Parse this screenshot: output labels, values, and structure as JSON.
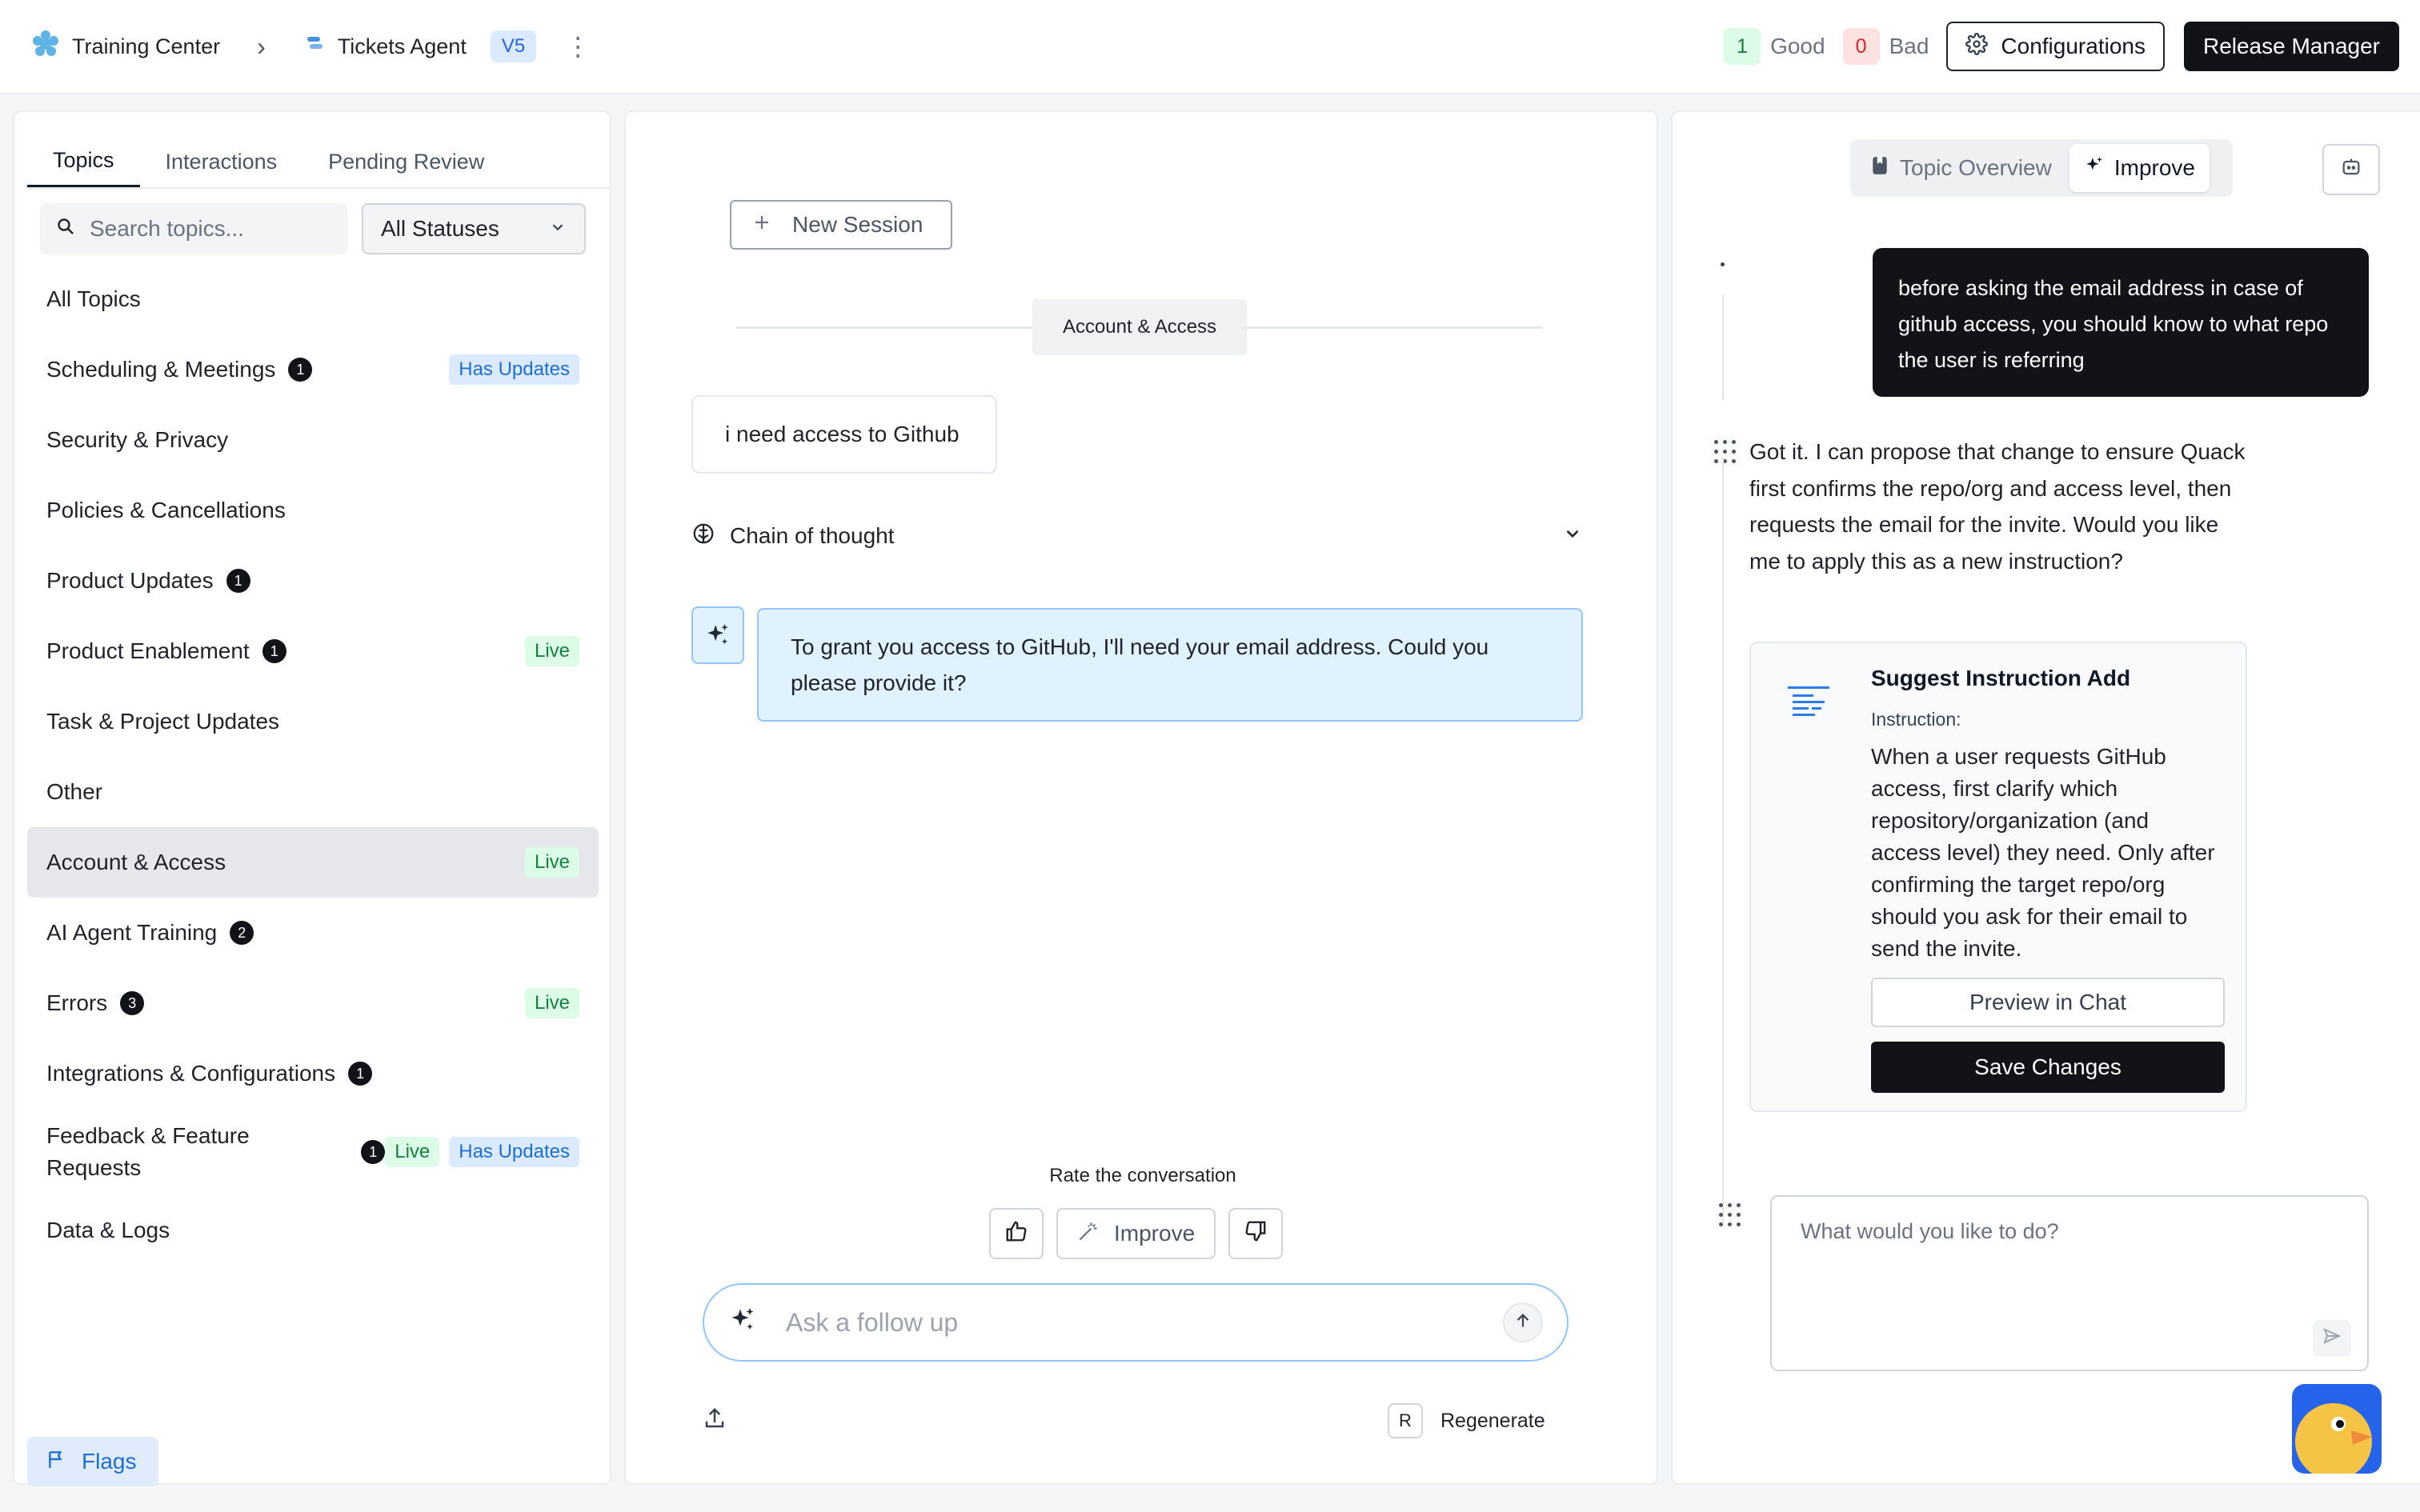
{
  "header": {
    "breadcrumb_root": "Training Center",
    "breadcrumb_agent": "Tickets Agent",
    "version": "V5",
    "good_count": "1",
    "good_label": "Good",
    "bad_count": "0",
    "bad_label": "Bad",
    "configurations_label": "Configurations",
    "release_manager_label": "Release Manager"
  },
  "left": {
    "tabs": [
      "Topics",
      "Interactions",
      "Pending Review"
    ],
    "active_tab": "Topics",
    "search_placeholder": "Search topics...",
    "status_filter": "All Statuses",
    "topics": [
      {
        "name": "All Topics",
        "count": null,
        "live": false,
        "updates": false,
        "selected": false
      },
      {
        "name": "Scheduling & Meetings",
        "count": "1",
        "live": false,
        "updates": true,
        "selected": false
      },
      {
        "name": "Security & Privacy",
        "count": null,
        "live": false,
        "updates": false,
        "selected": false
      },
      {
        "name": "Policies & Cancellations",
        "count": null,
        "live": false,
        "updates": false,
        "selected": false
      },
      {
        "name": "Product Updates",
        "count": "1",
        "live": false,
        "updates": false,
        "selected": false
      },
      {
        "name": "Product Enablement",
        "count": "1",
        "live": true,
        "updates": false,
        "selected": false
      },
      {
        "name": "Task & Project Updates",
        "count": null,
        "live": false,
        "updates": false,
        "selected": false
      },
      {
        "name": "Other",
        "count": null,
        "live": false,
        "updates": false,
        "selected": false
      },
      {
        "name": "Account & Access",
        "count": null,
        "live": true,
        "updates": false,
        "selected": true
      },
      {
        "name": "AI Agent Training",
        "count": "2",
        "live": false,
        "updates": false,
        "selected": false
      },
      {
        "name": "Errors",
        "count": "3",
        "live": true,
        "updates": false,
        "selected": false
      },
      {
        "name": "Integrations & Configurations",
        "count": "1",
        "live": false,
        "updates": false,
        "selected": false
      },
      {
        "name": "Feedback & Feature Requests",
        "count": "1",
        "live": true,
        "updates": true,
        "selected": false,
        "two_line": true
      },
      {
        "name": "Data & Logs",
        "count": null,
        "live": false,
        "updates": false,
        "selected": false
      }
    ],
    "live_label": "Live",
    "updates_label": "Has Updates",
    "flags_label": "Flags"
  },
  "middle": {
    "new_session_label": "New Session",
    "topic_divider": "Account & Access",
    "user_message": "i need access to Github",
    "chain_of_thought_label": "Chain of thought",
    "agent_message": "To grant you access to GitHub, I'll need your email address. Could you please provide it?",
    "rate_label": "Rate the conversation",
    "improve_label": "Improve",
    "ask_placeholder": "Ask a follow up",
    "regenerate_key": "R",
    "regenerate_label": "Regenerate"
  },
  "right": {
    "tab_overview": "Topic Overview",
    "tab_improve": "Improve",
    "user_bubble": "before asking the email address in case of github access, you should know to what repo the user is referring",
    "bot_reply": "Got it. I can propose that change to ensure Quack first confirms the repo/org and access level, then requests the email for the invite. Would you like me to apply this as a new instruction?",
    "suggestion": {
      "title": "Suggest Instruction Add",
      "label": "Instruction:",
      "text": "When a user requests GitHub access, first clarify which repository/organization (and access level) they need. Only after confirming the target repo/org should you ask for their email to send the invite.",
      "preview_label": "Preview in Chat",
      "save_label": "Save Changes"
    },
    "input_placeholder": "What would you like to do?"
  },
  "colors": {
    "accent_blue": "#1d6fd6",
    "live_green": "#15803d",
    "dark": "#111318"
  }
}
